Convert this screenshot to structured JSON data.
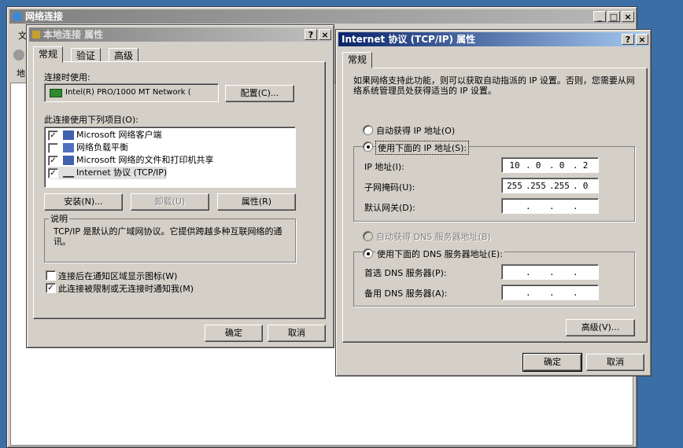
{
  "bg_window": {
    "title": "网络连接",
    "left_edge_chars": [
      "文",
      "地"
    ]
  },
  "local_props": {
    "title": "本地连接 属性",
    "tabs": [
      "常规",
      "验证",
      "高级"
    ],
    "connect_using_label": "连接时使用:",
    "adapter": "Intel(R) PRO/1000 MT Network (",
    "configure_btn": "配置(C)...",
    "items_label": "此连接使用下列项目(O):",
    "items": [
      {
        "label": "Microsoft 网络客户端",
        "checked": true
      },
      {
        "label": "网络负载平衡",
        "checked": false
      },
      {
        "label": "Microsoft 网络的文件和打印机共享",
        "checked": true
      },
      {
        "label": "Internet 协议 (TCP/IP)",
        "checked": true
      }
    ],
    "install_btn": "安装(N)...",
    "uninstall_btn": "卸载(U)",
    "properties_btn": "属性(R)",
    "description_title": "说明",
    "description_text": "TCP/IP 是默认的广域网协议。它提供跨越多种互联网络的通讯。",
    "show_icon_label": "连接后在通知区域显示图标(W)",
    "notify_label": "此连接被限制或无连接时通知我(M)",
    "ok_btn": "确定",
    "cancel_btn": "取消"
  },
  "tcpip": {
    "title": "Internet 协议 (TCP/IP) 属性",
    "tab": "常规",
    "intro": "如果网络支持此功能，则可以获取自动指派的 IP 设置。否则，您需要从网络系统管理员处获得适当的 IP 设置。",
    "auto_ip_label": "自动获得 IP 地址(O)",
    "manual_ip_label": "使用下面的 IP 地址(S):",
    "ip_label": "IP 地址(I):",
    "ip_value": [
      "10",
      "0",
      "0",
      "2"
    ],
    "subnet_label": "子网掩码(U):",
    "subnet_value": [
      "255",
      "255",
      "255",
      "0"
    ],
    "gateway_label": "默认网关(D):",
    "gateway_value": [
      "",
      "",
      "",
      ""
    ],
    "auto_dns_label": "自动获得 DNS 服务器地址(B)",
    "manual_dns_label": "使用下面的 DNS 服务器地址(E):",
    "pref_dns_label": "首选 DNS 服务器(P):",
    "alt_dns_label": "备用 DNS 服务器(A):",
    "advanced_btn": "高级(V)...",
    "ok_btn": "确定",
    "cancel_btn": "取消"
  },
  "controls": {
    "min": "_",
    "max": "□",
    "close": "×",
    "help": "?"
  }
}
